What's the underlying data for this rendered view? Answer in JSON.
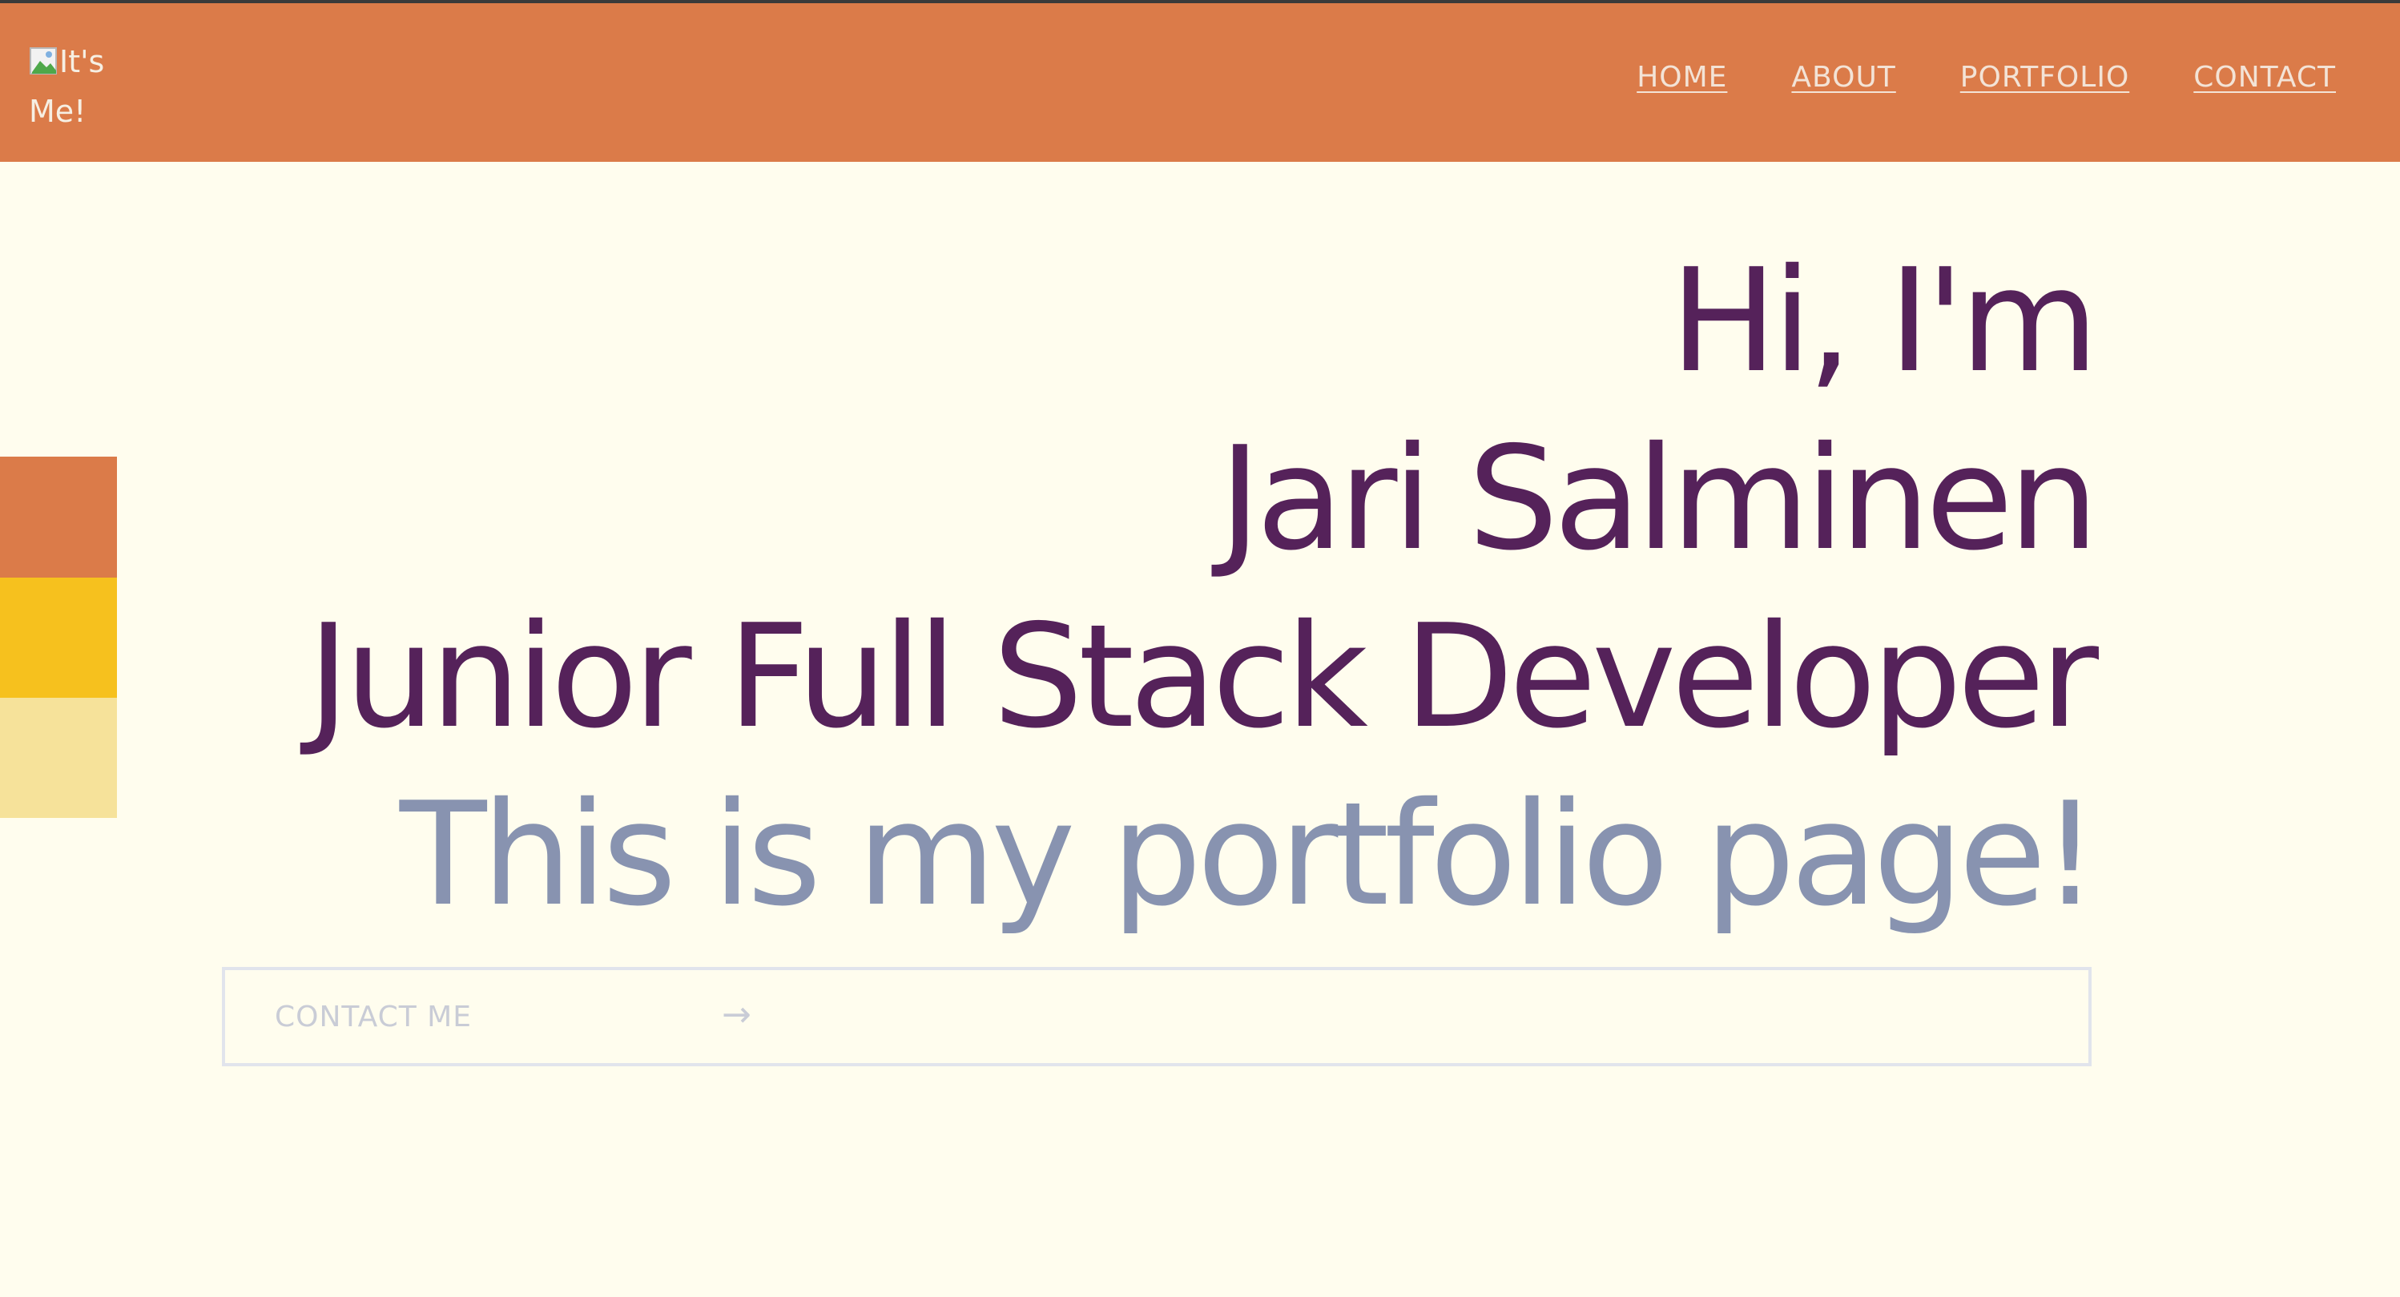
{
  "header": {
    "logo_alt": "It's Me!",
    "nav": [
      "HOME",
      "ABOUT",
      "PORTFOLIO",
      "CONTACT"
    ]
  },
  "hero": {
    "line1": "Hi, I'm",
    "line2": "Jari Salminen",
    "line3": "Junior Full Stack Developer",
    "line4": "This is my portfolio page!"
  },
  "cta": {
    "label": "CONTACT ME",
    "arrow": "→"
  },
  "colors": {
    "header_bg": "#db7b49",
    "page_bg": "#fffdee",
    "heading": "#55225a",
    "subheading": "#8893b0",
    "swatch_orange": "#db7b49",
    "swatch_yellow": "#f6c11e",
    "swatch_light": "#f6e29a"
  },
  "icons": {
    "logo": "broken-image-icon",
    "cta_arrow": "arrow-right-icon"
  }
}
